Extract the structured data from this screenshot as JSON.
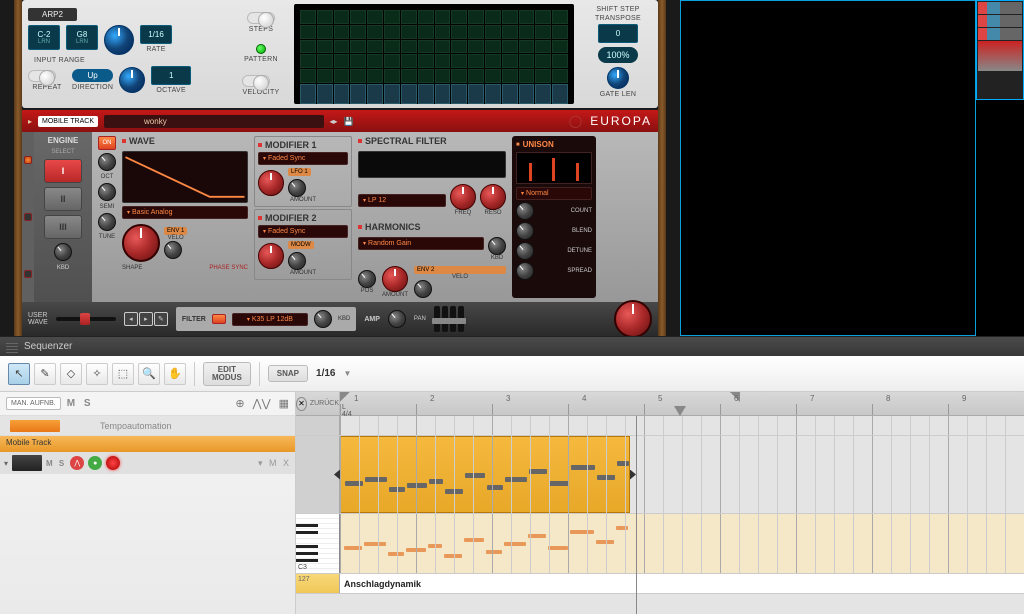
{
  "arp": {
    "title": "ARP2",
    "range_low": "C-2",
    "range_high": "G8",
    "lrn": "LRN",
    "input_range_label": "INPUT RANGE",
    "rate": "1/16",
    "rate_label": "RATE",
    "octave": "1",
    "octave_label": "OCTAVE",
    "repeat_label": "REPEAT",
    "direction": "Up",
    "direction_label": "DIRECTION",
    "steps_label": "STEPS",
    "pattern_label": "PATTERN",
    "velocity_label": "VELOCITY",
    "shift_step_label": "SHIFT STEP",
    "transpose_label": "TRANSPOSE",
    "transpose": "0",
    "gate": "100%",
    "gate_len_label": "GATE LEN"
  },
  "europa": {
    "mobile_track": "MOBILE TRACK",
    "patch": "wonky",
    "brand": "EUROPA",
    "engine": {
      "title": "ENGINE",
      "sub": "SELECT",
      "buttons": [
        "I",
        "II",
        "III"
      ],
      "kbd": "KBD"
    },
    "wave": {
      "title": "WAVE",
      "algo": "Basic Analog",
      "shape": "SHAPE",
      "phase_sync": "PHASE SYNC",
      "on": "ON"
    },
    "osc": {
      "oct": "OCT",
      "semi": "SEMI",
      "tune": "TUNE"
    },
    "mod1": {
      "title": "MODIFIER 1",
      "type": "Faded Sync",
      "amount": "AMOUNT",
      "lfo": "LFO 1"
    },
    "mod2": {
      "title": "MODIFIER 2",
      "type": "Faded Sync",
      "amount": "AMOUNT",
      "env": "ENV 1",
      "velo": "VELO",
      "modw": "MODW"
    },
    "spectral": {
      "title": "SPECTRAL FILTER",
      "type": "LP 12",
      "freq": "FREQ",
      "reso": "RESO",
      "kbd": "KBD",
      "velo": "VELO",
      "env": "ENV 2"
    },
    "harmonics": {
      "title": "HARMONICS",
      "type": "Random Gain",
      "pos": "POS",
      "amount": "AMOUNT"
    },
    "unison": {
      "title": "UNISON",
      "algo": "Normal",
      "count": "COUNT",
      "blend": "BLEND",
      "detune": "DETUNE",
      "spread": "SPREAD"
    },
    "footer": {
      "user_wave": "USER\nWAVE",
      "filter": "FILTER",
      "filter_type": "K35 LP 12dB",
      "kbd": "KBD",
      "amp": "AMP",
      "pan": "PAN"
    }
  },
  "sequencer": {
    "title": "Sequenzer",
    "edit_modus": "EDIT\nMODUS",
    "snap_label": "SNAP",
    "snap_value": "1/16",
    "man_aufn": "MAN. AUFNB.",
    "back": "ZURÜCK",
    "timesig": "L\n4/4",
    "tempo_automation": "Tempoautomation",
    "track_name": "Mobile Track",
    "velocity_label": "Anschlagdynamik",
    "velocity_num": "127",
    "c3": "C3",
    "bars": [
      1,
      2,
      3,
      4,
      5,
      6,
      7,
      8,
      9
    ]
  }
}
